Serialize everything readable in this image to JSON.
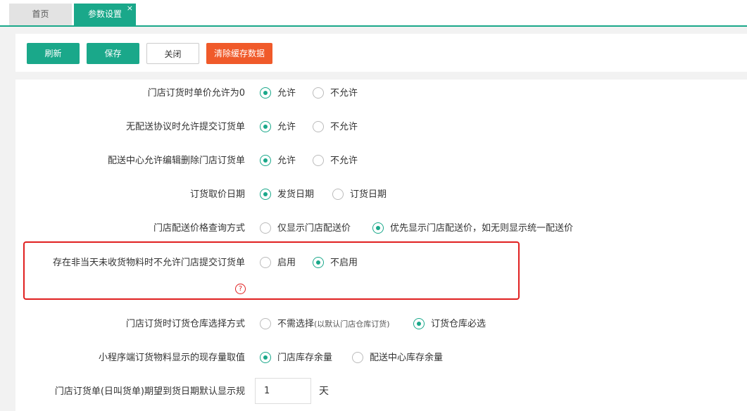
{
  "tabs": {
    "home": "首页",
    "settings": "参数设置",
    "close_icon": "×"
  },
  "toolbar": {
    "refresh": "刷新",
    "save": "保存",
    "close": "关闭",
    "clear_cache": "清除缓存数据"
  },
  "settings": [
    {
      "label": "门店订货时单价允许为0",
      "options": [
        "允许",
        "不允许"
      ],
      "selected": 0
    },
    {
      "label": "无配送协议时允许提交订货单",
      "options": [
        "允许",
        "不允许"
      ],
      "selected": 0
    },
    {
      "label": "配送中心允许编辑删除门店订货单",
      "options": [
        "允许",
        "不允许"
      ],
      "selected": 0
    },
    {
      "label": "订货取价日期",
      "options": [
        "发货日期",
        "订货日期"
      ],
      "selected": 0
    },
    {
      "label": "门店配送价格查询方式",
      "options": [
        "仅显示门店配送价",
        "优先显示门店配送价，如无则显示统一配送价"
      ],
      "selected": 1
    },
    {
      "label": "存在非当天未收货物料时不允许门店提交订货单",
      "options": [
        "启用",
        "不启用"
      ],
      "selected": 1
    },
    {
      "label": "门店订货时订货仓库选择方式",
      "options": [
        "不需选择",
        "订货仓库必选"
      ],
      "option0_note": "(以默认门店仓库订货)",
      "selected": 1
    },
    {
      "label": "小程序端订货物料显示的现存量取值",
      "options": [
        "门店库存余量",
        "配送中心库存余量"
      ],
      "selected": 0
    }
  ],
  "last_setting": {
    "label": "门店订货单(日叫货单)期望到货日期默认显示规",
    "value": "1",
    "unit": "天"
  },
  "help_icon": "?",
  "colors": {
    "accent": "#1aa88a",
    "danger": "#f05a2a",
    "highlight": "#e02020"
  }
}
